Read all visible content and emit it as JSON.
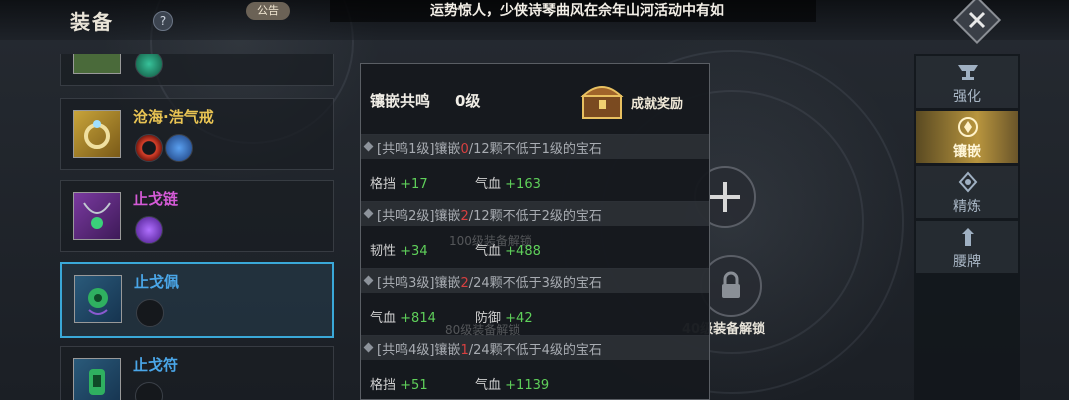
{
  "header": {
    "title": "装备",
    "help_label": "?",
    "notice_tag": "公告",
    "marquee_text": "运势惊人，少侠诗琴曲风在佘年山河活动中有如"
  },
  "equipment_list": [
    {
      "name": "",
      "name_color": "#e9c453",
      "icon": "jade-beads-icon",
      "gems": [
        "green-dragon-gem-icon"
      ]
    },
    {
      "name": "沧海·浩气戒",
      "name_color": "#e9c453",
      "icon": "ring-icon",
      "gems": [
        "red-ring-gem-icon",
        "blue-vase-gem-icon"
      ]
    },
    {
      "name": "止戈链",
      "name_color": "#d45ad6",
      "icon": "necklace-icon",
      "gems": [
        "purple-gem-icon"
      ]
    },
    {
      "name": "止戈佩",
      "name_color": "#4aa6e8",
      "icon": "pendant-icon",
      "gems": [],
      "selected": true
    },
    {
      "name": "止戈符",
      "name_color": "#4aa6e8",
      "icon": "talisman-icon",
      "gems": []
    }
  ],
  "resonance_popup": {
    "title": "镶嵌共鸣",
    "level": "0级",
    "reward_label": "成就奖励",
    "tiers": [
      {
        "tier": "[共鸣1级]",
        "prefix": "镶嵌",
        "current": "0",
        "requirement": "/12颗不低于1级的宝石",
        "stats": [
          {
            "label": "格挡",
            "value": "+17"
          },
          {
            "label": "气血",
            "value": "+163"
          }
        ]
      },
      {
        "tier": "[共鸣2级]",
        "prefix": "镶嵌",
        "current": "2",
        "requirement": "/12颗不低于2级的宝石",
        "stats": [
          {
            "label": "韧性",
            "value": "+34"
          },
          {
            "label": "气血",
            "value": "+488"
          }
        ]
      },
      {
        "tier": "[共鸣3级]",
        "prefix": "镶嵌",
        "current": "2",
        "requirement": "/24颗不低于3级的宝石",
        "stats": [
          {
            "label": "气血",
            "value": "+814"
          },
          {
            "label": "防御",
            "value": "+42"
          }
        ]
      },
      {
        "tier": "[共鸣4级]",
        "prefix": "镶嵌",
        "current": "1",
        "requirement": "/24颗不低于4级的宝石",
        "stats": [
          {
            "label": "格挡",
            "value": "+51"
          },
          {
            "label": "气血",
            "value": "+1139"
          }
        ]
      }
    ]
  },
  "gem_slots": {
    "unlock_100": "100级装备解锁",
    "unlock_80": "80级装备解锁",
    "unlock_40": "40级装备解锁"
  },
  "tabs": [
    {
      "label": "强化",
      "icon": "anvil-icon",
      "active": false
    },
    {
      "label": "镶嵌",
      "icon": "gem-inlay-icon",
      "active": true
    },
    {
      "label": "精炼",
      "icon": "refine-icon",
      "active": false
    },
    {
      "label": "腰牌",
      "icon": "waist-badge-icon",
      "active": false
    }
  ]
}
